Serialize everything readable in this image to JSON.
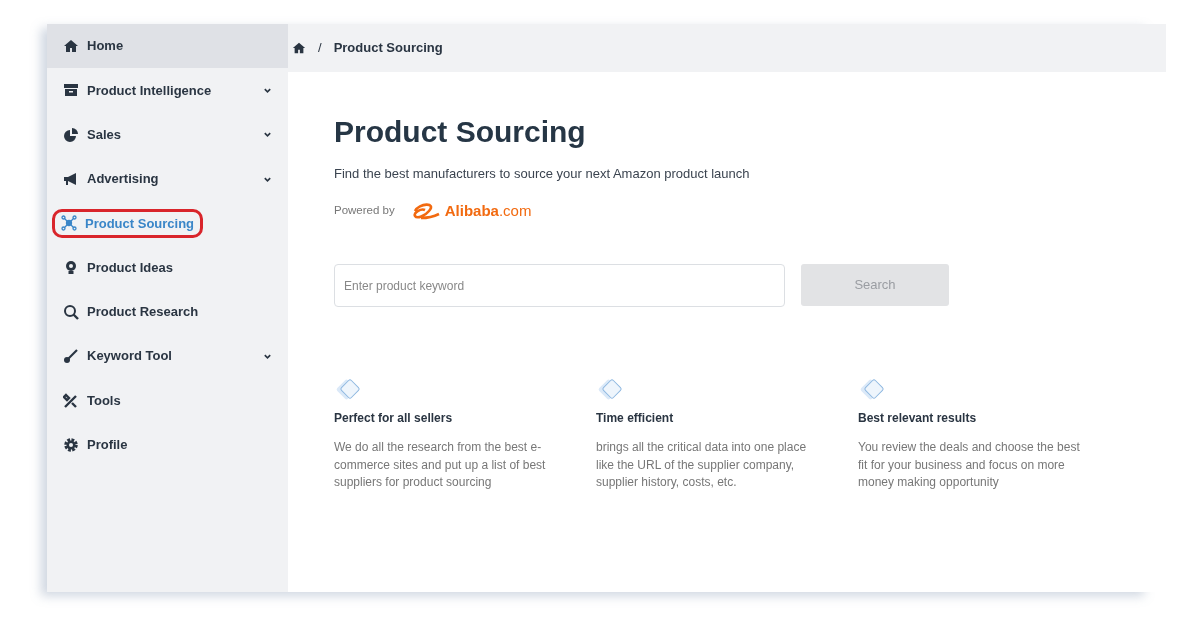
{
  "sidebar": {
    "items": [
      {
        "label": "Home",
        "expandable": false,
        "selected": false,
        "highlighted": true,
        "circled": false
      },
      {
        "label": "Product Intelligence",
        "expandable": true,
        "selected": false,
        "highlighted": false,
        "circled": false
      },
      {
        "label": "Sales",
        "expandable": true,
        "selected": false,
        "highlighted": false,
        "circled": false
      },
      {
        "label": "Advertising",
        "expandable": true,
        "selected": false,
        "highlighted": false,
        "circled": false
      },
      {
        "label": "Product Sourcing",
        "expandable": false,
        "selected": true,
        "highlighted": false,
        "circled": true
      },
      {
        "label": "Product Ideas",
        "expandable": false,
        "selected": false,
        "highlighted": false,
        "circled": false
      },
      {
        "label": "Product Research",
        "expandable": false,
        "selected": false,
        "highlighted": false,
        "circled": false
      },
      {
        "label": "Keyword Tool",
        "expandable": true,
        "selected": false,
        "highlighted": false,
        "circled": false
      },
      {
        "label": "Tools",
        "expandable": false,
        "selected": false,
        "highlighted": false,
        "circled": false
      },
      {
        "label": "Profile",
        "expandable": false,
        "selected": false,
        "highlighted": false,
        "circled": false
      }
    ]
  },
  "breadcrumb": {
    "separator": "/",
    "current": "Product Sourcing"
  },
  "page": {
    "title": "Product Sourcing",
    "subtitle": "Find the best manufacturers to source your next Amazon product launch",
    "powered_by": "Powered by",
    "logo_brand": "Alibaba",
    "logo_suffix": ".com"
  },
  "search": {
    "placeholder": "Enter product keyword",
    "button": "Search",
    "disabled": true
  },
  "features": [
    {
      "title": "Perfect for all sellers",
      "text": "We do all the research from the best e-commerce sites and put up a list of best suppliers for product sourcing"
    },
    {
      "title": "Time efficient",
      "text": "brings all the critical data into one place like the URL of the supplier company, supplier history, costs, etc."
    },
    {
      "title": "Best relevant results",
      "text": "You review the deals and choose the best fit for your business and focus on more money making opportunity"
    }
  ]
}
